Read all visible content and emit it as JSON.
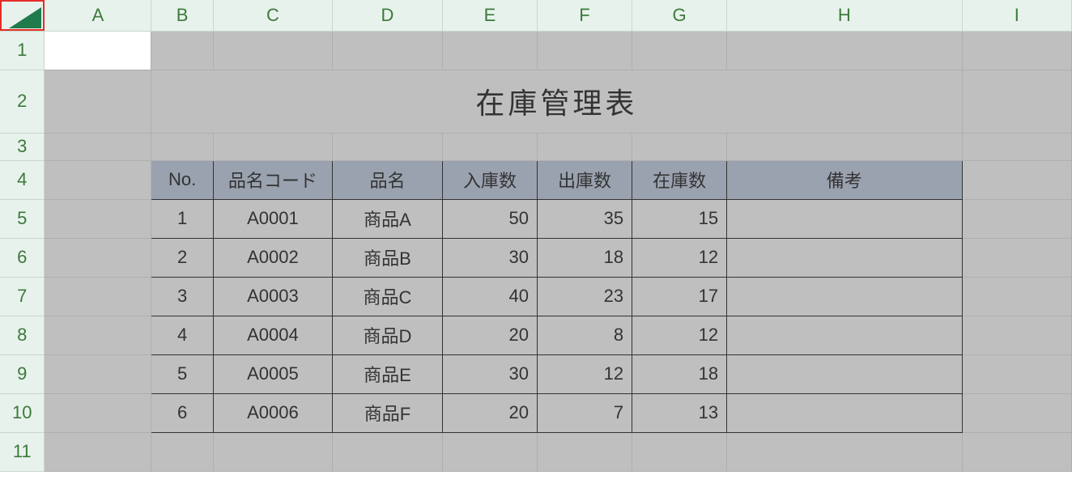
{
  "columns": {
    "A": "A",
    "B": "B",
    "C": "C",
    "D": "D",
    "E": "E",
    "F": "F",
    "G": "G",
    "H": "H",
    "I": "I"
  },
  "rows": {
    "1": "1",
    "2": "2",
    "3": "3",
    "4": "4",
    "5": "5",
    "6": "6",
    "7": "7",
    "8": "8",
    "9": "9",
    "10": "10",
    "11": "11"
  },
  "title": "在庫管理表",
  "headers": {
    "no": "No.",
    "code": "品名コード",
    "name": "品名",
    "in": "入庫数",
    "out": "出庫数",
    "stock": "在庫数",
    "note": "備考"
  },
  "items": [
    {
      "no": "1",
      "code": "A0001",
      "name": "商品A",
      "in": "50",
      "out": "35",
      "stock": "15",
      "note": ""
    },
    {
      "no": "2",
      "code": "A0002",
      "name": "商品B",
      "in": "30",
      "out": "18",
      "stock": "12",
      "note": ""
    },
    {
      "no": "3",
      "code": "A0003",
      "name": "商品C",
      "in": "40",
      "out": "23",
      "stock": "17",
      "note": ""
    },
    {
      "no": "4",
      "code": "A0004",
      "name": "商品D",
      "in": "20",
      "out": "8",
      "stock": "12",
      "note": ""
    },
    {
      "no": "5",
      "code": "A0005",
      "name": "商品E",
      "in": "30",
      "out": "12",
      "stock": "18",
      "note": ""
    },
    {
      "no": "6",
      "code": "A0006",
      "name": "商品F",
      "in": "20",
      "out": "7",
      "stock": "13",
      "note": ""
    }
  ]
}
